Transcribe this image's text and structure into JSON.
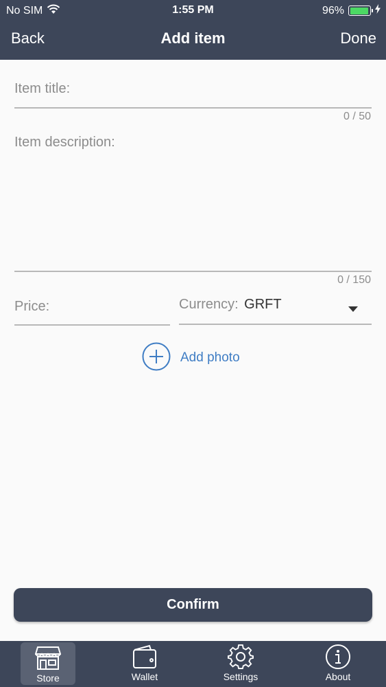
{
  "status_bar": {
    "carrier": "No SIM",
    "time": "1:55 PM",
    "battery_percent": "96%",
    "battery_level": 0.96,
    "battery_color": "#4cd964"
  },
  "nav": {
    "back_label": "Back",
    "title": "Add item",
    "done_label": "Done"
  },
  "form": {
    "title_placeholder": "Item title:",
    "title_counter": "0 / 50",
    "description_placeholder": "Item description:",
    "description_counter": "0 / 150",
    "price_placeholder": "Price:",
    "currency_label": "Currency:",
    "currency_value": "GRFT",
    "add_photo_label": "Add photo"
  },
  "confirm_label": "Confirm",
  "tabs": [
    {
      "label": "Store",
      "icon": "store-icon",
      "active": true
    },
    {
      "label": "Wallet",
      "icon": "wallet-icon",
      "active": false
    },
    {
      "label": "Settings",
      "icon": "gear-icon",
      "active": false
    },
    {
      "label": "About",
      "icon": "info-icon",
      "active": false
    }
  ],
  "colors": {
    "header": "#3d4659",
    "accent": "#3f7dc4",
    "background": "#fafafa"
  }
}
